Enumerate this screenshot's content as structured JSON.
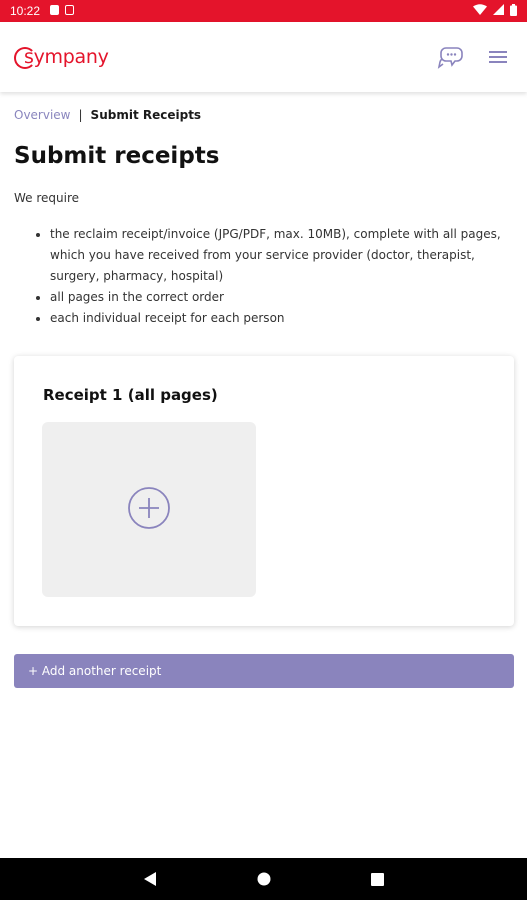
{
  "status_bar": {
    "time": "10:22",
    "icons": [
      "notification-icon",
      "sim-icon",
      "wifi-icon",
      "signal-icon",
      "battery-icon"
    ]
  },
  "header": {
    "brand": "sympany",
    "brand_color": "#e4142b",
    "icons": [
      "chat-icon",
      "menu-icon"
    ]
  },
  "breadcrumb": {
    "parent": "Overview",
    "separator": "|",
    "current": "Submit Receipts"
  },
  "page": {
    "title": "Submit receipts",
    "intro": "We require",
    "requirements": [
      "the reclaim receipt/invoice (JPG/PDF, max. 10MB), complete with all pages, which you have received from your service provider (doctor, therapist, surgery, pharmacy, hospital)",
      "all pages in the correct order",
      "each individual receipt for each person"
    ]
  },
  "receipt_card": {
    "title": "Receipt 1 (all pages)",
    "upload_icon": "plus-circle-icon"
  },
  "actions": {
    "add_receipt_label": "+ Add another receipt",
    "accent_color": "#8a84bd"
  },
  "nav_bar": {
    "icons": [
      "back-icon",
      "home-icon",
      "recents-icon"
    ]
  }
}
